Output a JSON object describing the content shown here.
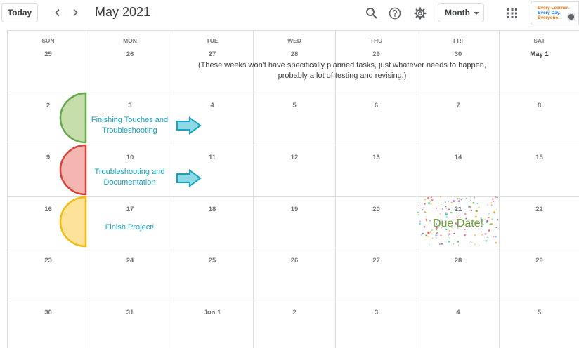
{
  "header": {
    "today_label": "Today",
    "title": "May 2021",
    "view_label": "Month",
    "logo_lines": [
      "Every Learner.",
      "Every Day.",
      "Everyone."
    ]
  },
  "calendar": {
    "weekdays": [
      "SUN",
      "MON",
      "TUE",
      "WED",
      "THU",
      "FRI",
      "SAT"
    ],
    "weeks": [
      [
        "25",
        "26",
        "27",
        "28",
        "29",
        "30",
        "May 1"
      ],
      [
        "2",
        "3",
        "4",
        "5",
        "6",
        "7",
        "8"
      ],
      [
        "9",
        "10",
        "11",
        "12",
        "13",
        "14",
        "15"
      ],
      [
        "16",
        "17",
        "18",
        "19",
        "20",
        "21",
        "22"
      ],
      [
        "23",
        "24",
        "25",
        "26",
        "27",
        "28",
        "29"
      ],
      [
        "30",
        "31",
        "Jun 1",
        "2",
        "3",
        "4",
        "5"
      ]
    ]
  },
  "note": "(These weeks won't have specifically planned tasks, just whatever needs to happen, probably a lot of testing and revising.)",
  "events": [
    {
      "label": "Finishing Touches and Troubleshooting",
      "fill": "#c6dfaa",
      "stroke": "#6aa84f"
    },
    {
      "label": "Troubleshooting and Documentation",
      "fill": "#f4b6b1",
      "stroke": "#d7413a"
    },
    {
      "label": "Finish Project!",
      "fill": "#fde29a",
      "stroke": "#f1bb14"
    }
  ],
  "due_label": "Due Date!",
  "colors": {
    "accent_text": "#12a4c0",
    "arrow_fill": "#8fd8e6",
    "arrow_stroke": "#12a4c0",
    "due_text": "#6aa332",
    "grid_line": "#dadce0"
  },
  "icons": [
    "chevron-left-icon",
    "chevron-right-icon",
    "search-icon",
    "help-icon",
    "settings-gear-icon",
    "apps-grid-icon",
    "caret-down-icon",
    "arrow-right-icon",
    "confetti-decoration"
  ]
}
